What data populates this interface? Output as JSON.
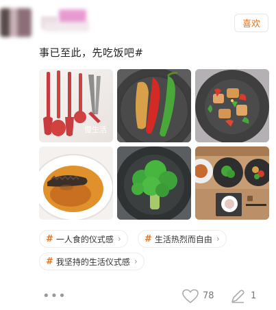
{
  "post": {
    "like_button_label": "喜欢",
    "text": "事已至此，先吃饭吧#",
    "image_watermark": "慢生活"
  },
  "tags": [
    {
      "hash": "#",
      "label": "一人食的仪式感",
      "chevron": "›"
    },
    {
      "hash": "#",
      "label": "生活热烈而自由",
      "chevron": "›"
    },
    {
      "hash": "#",
      "label": "我坚持的生活仪式感",
      "chevron": "›"
    }
  ],
  "footer": {
    "more": "•••",
    "like_count": "78",
    "comment_count": "1"
  },
  "colors": {
    "accent": "#e8731a",
    "text": "#222222",
    "muted": "#999999"
  },
  "icons": [
    "heart-outline-icon",
    "comment-pen-icon",
    "more-dots-icon",
    "hash-icon",
    "chevron-right-icon"
  ]
}
